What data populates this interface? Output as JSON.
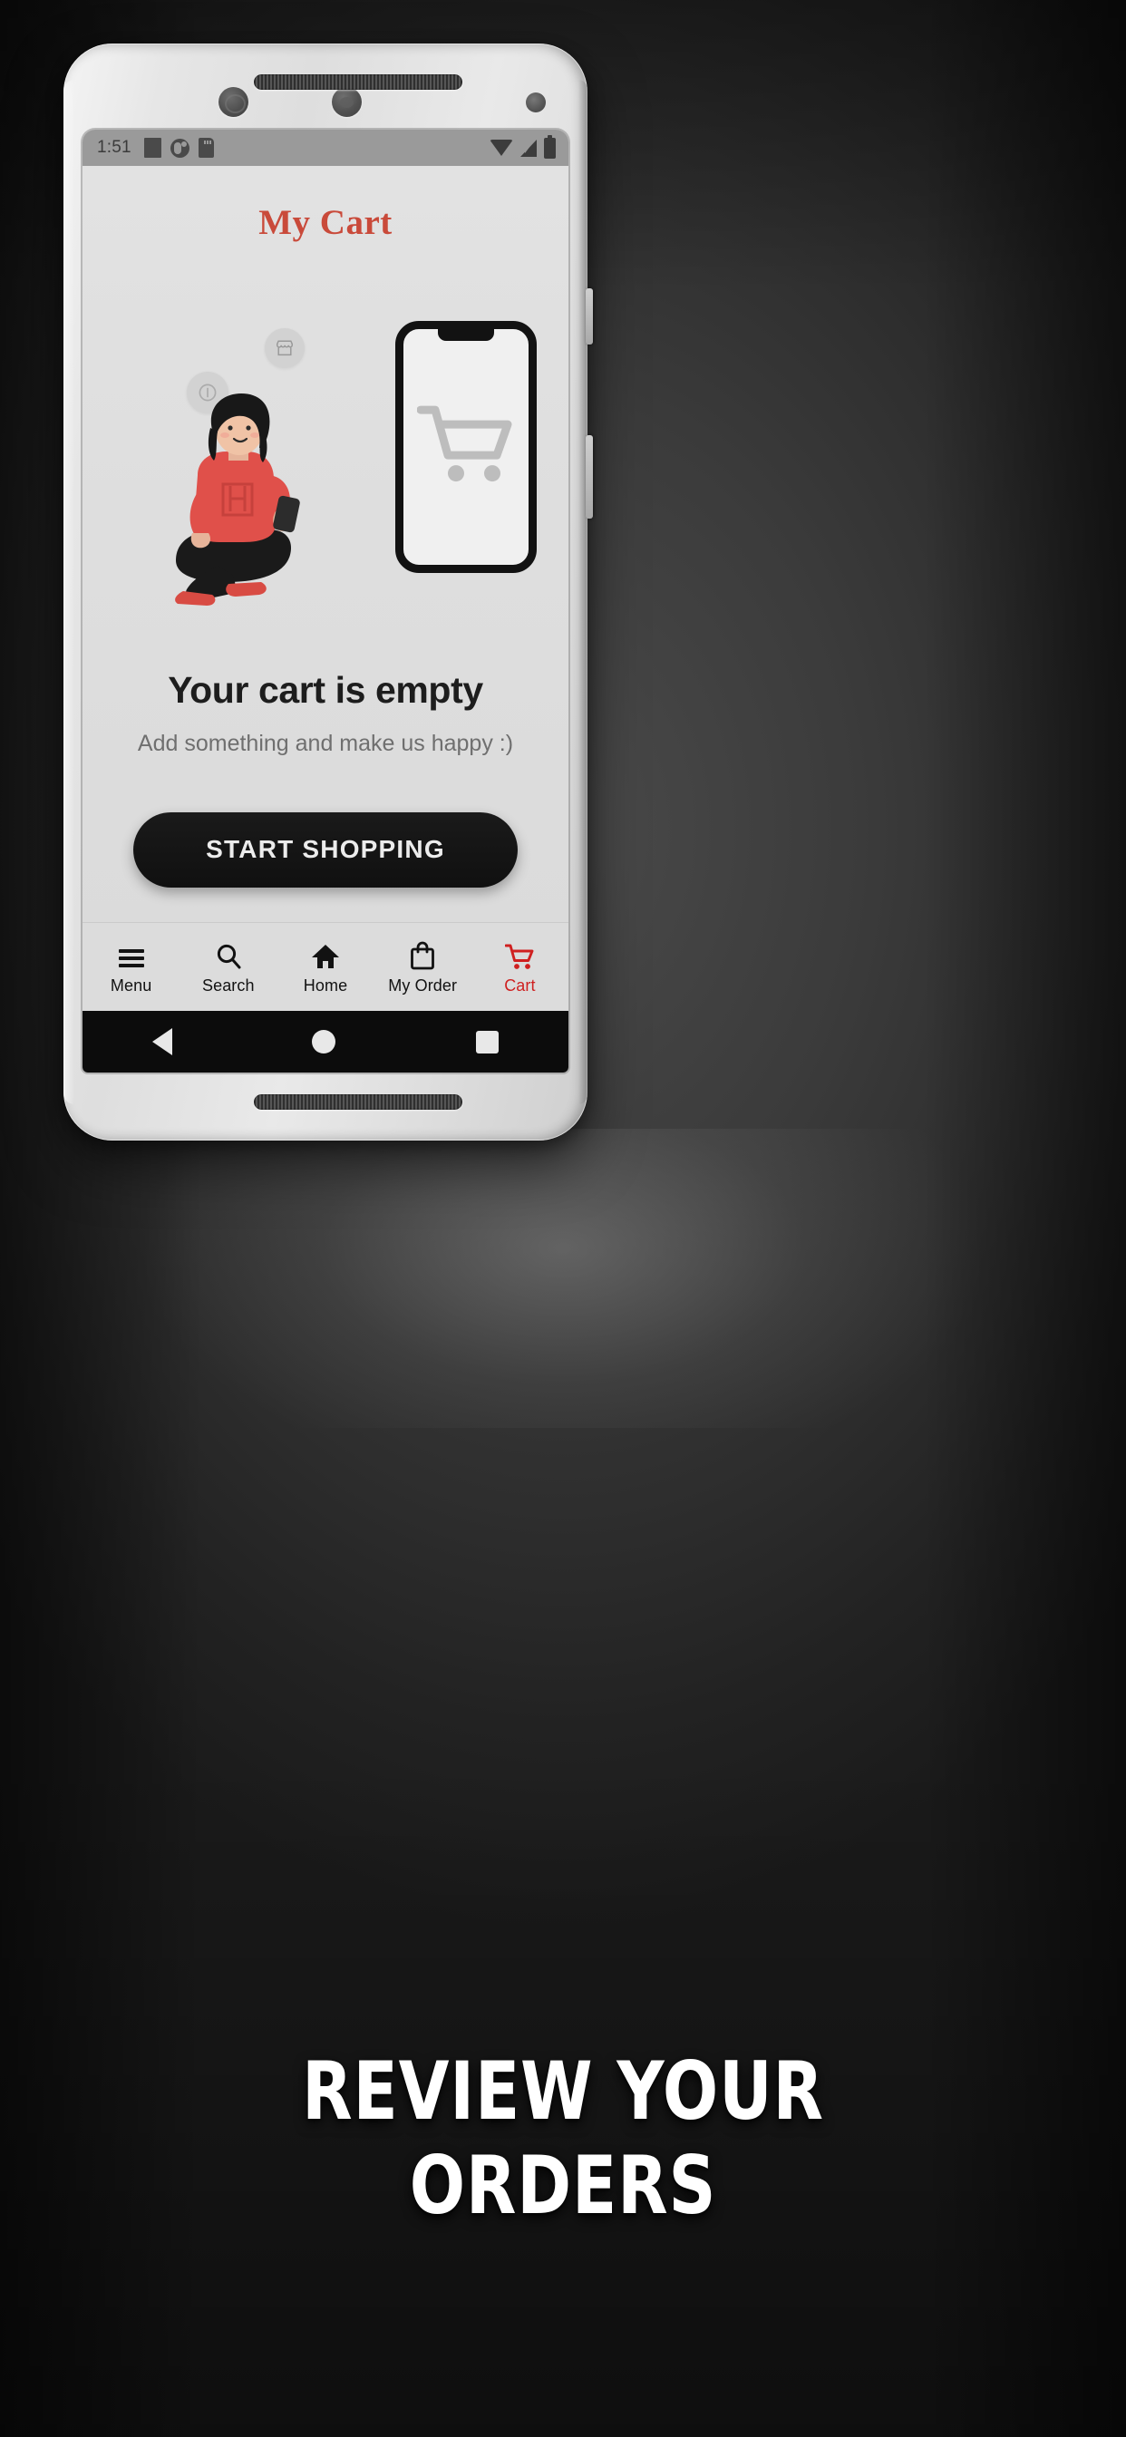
{
  "device": {
    "status_bar": {
      "time": "1:51",
      "left_icons": [
        "notification-square-icon",
        "notification-circle-icon",
        "sd-card-icon"
      ],
      "right_icons": [
        "wifi-icon",
        "cellular-signal-icon",
        "battery-icon"
      ]
    },
    "android_nav": {
      "back_label": "Back",
      "home_label": "Home",
      "recents_label": "Recent apps"
    }
  },
  "app": {
    "title": "My Cart",
    "title_color": "#C94A3A",
    "empty_state": {
      "illustration_name": "empty-cart-illustration",
      "heading": "Your cart is empty",
      "subtitle": "Add something and make us happy :)",
      "cta_label": "START SHOPPING"
    },
    "bottom_nav": {
      "active_color": "#CF2020",
      "items": [
        {
          "label": "Menu",
          "icon": "hamburger-menu-icon",
          "active": false
        },
        {
          "label": "Search",
          "icon": "search-icon",
          "active": false
        },
        {
          "label": "Home",
          "icon": "home-icon",
          "active": false
        },
        {
          "label": "My Order",
          "icon": "shopping-bag-icon",
          "active": false
        },
        {
          "label": "Cart",
          "icon": "shopping-cart-icon",
          "active": true
        }
      ]
    }
  },
  "caption": {
    "line1": "REVIEW YOUR",
    "line2": "ORDERS"
  }
}
